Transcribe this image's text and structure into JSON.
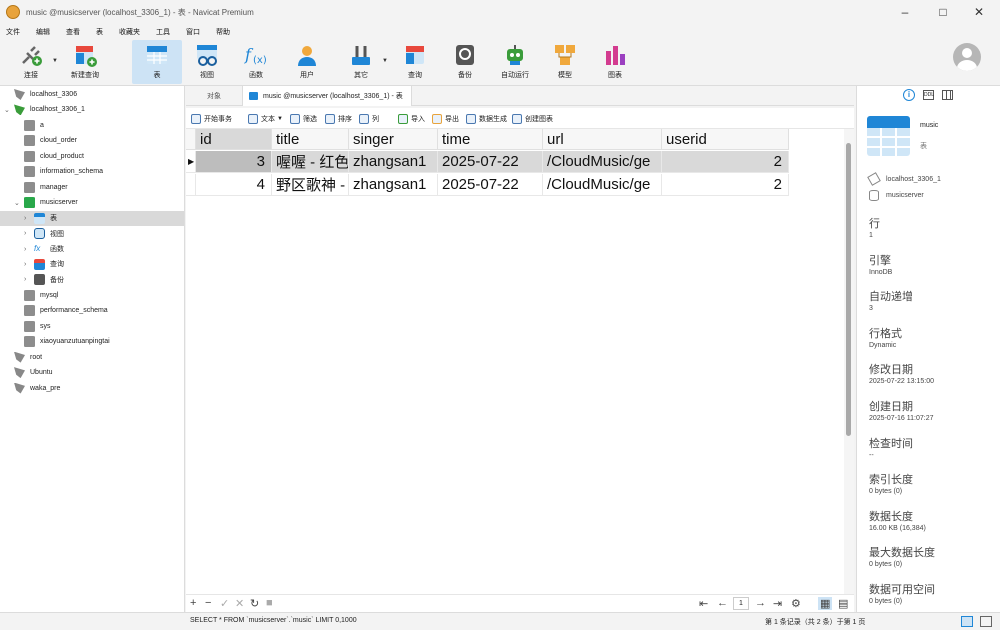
{
  "window": {
    "title": "music @musicserver (localhost_3306_1) - 表 - Navicat Premium"
  },
  "menu": [
    "文件",
    "编辑",
    "查看",
    "表",
    "收藏夹",
    "工具",
    "窗口",
    "帮助"
  ],
  "toolbar": {
    "connect": "连接",
    "new_query": "新建查询",
    "table": "表",
    "view": "视图",
    "function": "函数",
    "user": "用户",
    "other": "其它",
    "query": "查询",
    "backup": "备份",
    "automation": "自动运行",
    "model": "模型",
    "chart": "图表"
  },
  "tree": [
    {
      "label": "localhost_3306",
      "level": 0,
      "kind": "conn",
      "expanded": false
    },
    {
      "label": "localhost_3306_1",
      "level": 0,
      "kind": "conn-on",
      "expanded": true
    },
    {
      "label": "a",
      "level": 1,
      "kind": "db"
    },
    {
      "label": "cloud_order",
      "level": 1,
      "kind": "db"
    },
    {
      "label": "cloud_product",
      "level": 1,
      "kind": "db"
    },
    {
      "label": "information_schema",
      "level": 1,
      "kind": "db"
    },
    {
      "label": "manager",
      "level": 1,
      "kind": "db"
    },
    {
      "label": "musicserver",
      "level": 1,
      "kind": "db-on",
      "expanded": true
    },
    {
      "label": "表",
      "level": 2,
      "kind": "table",
      "selected": true
    },
    {
      "label": "视图",
      "level": 2,
      "kind": "view"
    },
    {
      "label": "函数",
      "level": 2,
      "kind": "func"
    },
    {
      "label": "查询",
      "level": 2,
      "kind": "query"
    },
    {
      "label": "备份",
      "level": 2,
      "kind": "backup"
    },
    {
      "label": "mysql",
      "level": 1,
      "kind": "db"
    },
    {
      "label": "performance_schema",
      "level": 1,
      "kind": "db"
    },
    {
      "label": "sys",
      "level": 1,
      "kind": "db"
    },
    {
      "label": "xiaoyuanzutuanpingtai",
      "level": 1,
      "kind": "db"
    },
    {
      "label": "root",
      "level": 0,
      "kind": "conn"
    },
    {
      "label": "Ubuntu",
      "level": 0,
      "kind": "conn"
    },
    {
      "label": "waka_pre",
      "level": 0,
      "kind": "conn"
    }
  ],
  "tabs": {
    "objects": "对象",
    "active": "music @musicserver (localhost_3306_1) - 表"
  },
  "subtoolbar": {
    "begin_tx": "开始事务",
    "text": "文本",
    "filter": "筛选",
    "sort": "排序",
    "columns": "列",
    "import": "导入",
    "export": "导出",
    "data_gen": "数据生成",
    "create_chart": "创建图表"
  },
  "grid": {
    "columns": [
      "id",
      "title",
      "singer",
      "time",
      "url",
      "userid"
    ],
    "rows": [
      [
        "3",
        "喔喔 - 红色",
        "zhangsan1",
        "2025-07-22",
        "/CloudMusic/ge",
        "2"
      ],
      [
        "4",
        "野区歌神 -",
        "zhangsan1",
        "2025-07-22",
        "/CloudMusic/ge",
        "2"
      ]
    ]
  },
  "pager": {
    "page": "1"
  },
  "status": {
    "sql": "SELECT * FROM `musicserver`.`music` LIMIT 0,1000",
    "records": "第 1 条记录（共 2 条）于第 1 页"
  },
  "info": {
    "name": "music",
    "type": "表",
    "connection": "localhost_3306_1",
    "database": "musicserver",
    "props": [
      {
        "label": "行",
        "value": "1"
      },
      {
        "label": "引擎",
        "value": "InnoDB"
      },
      {
        "label": "自动递增",
        "value": "3"
      },
      {
        "label": "行格式",
        "value": "Dynamic"
      },
      {
        "label": "修改日期",
        "value": "2025-07-22 13:15:00"
      },
      {
        "label": "创建日期",
        "value": "2025-07-16 11:07:27"
      },
      {
        "label": "检查时间",
        "value": "--"
      },
      {
        "label": "索引长度",
        "value": "0 bytes (0)"
      },
      {
        "label": "数据长度",
        "value": "16.00 KB (16,384)"
      },
      {
        "label": "最大数据长度",
        "value": "0 bytes (0)"
      },
      {
        "label": "数据可用空间",
        "value": "0 bytes (0)"
      }
    ]
  }
}
